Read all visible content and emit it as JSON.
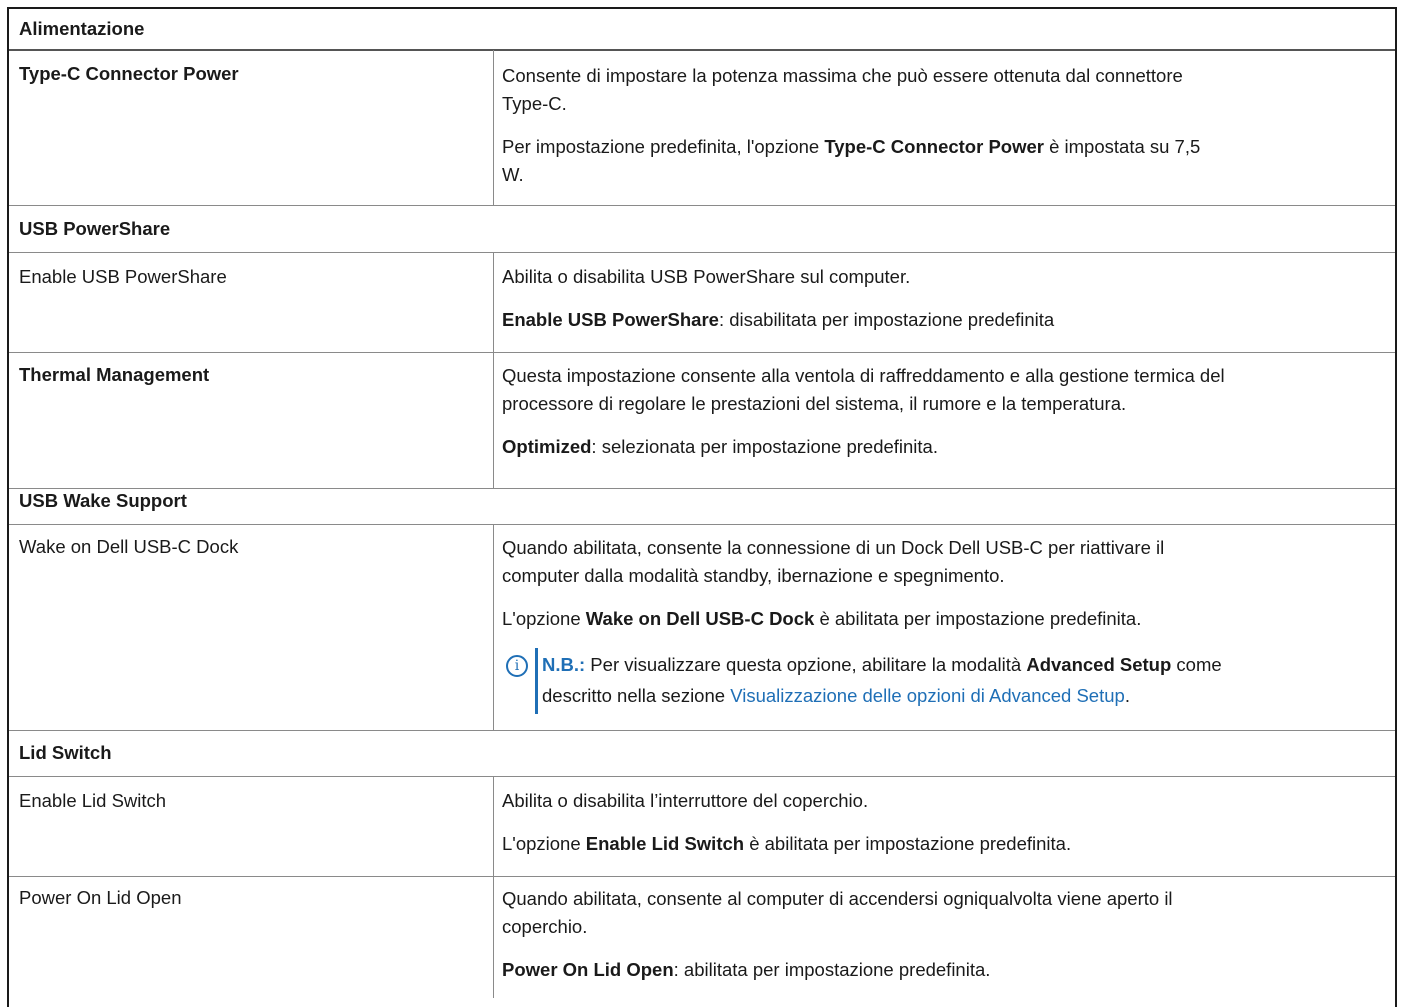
{
  "table": {
    "header": "Alimentazione",
    "type_c": {
      "name": "Type-C Connector Power",
      "desc_line1": "Consente di impostare la potenza massima che può essere ottenuta dal connettore",
      "desc_line2": "Type-C.",
      "default_pre": "Per impostazione predefinita, l'opzione ",
      "default_bold": "Type-C Connector Power",
      "default_post": " è impostata su 7,5",
      "default_line2": "W."
    },
    "usb_powershare": {
      "section": "USB PowerShare",
      "name": "Enable USB PowerShare",
      "desc": "Abilita o disabilita USB PowerShare sul computer.",
      "default_bold": "Enable USB PowerShare",
      "default_post": ": disabilitata per impostazione predefinita"
    },
    "thermal": {
      "name": "Thermal Management",
      "desc_line1": "Questa impostazione consente alla ventola di raffreddamento e alla gestione termica del",
      "desc_line2": "processore di regolare le prestazioni del sistema, il rumore e la temperatura.",
      "default_bold": "Optimized",
      "default_post": ": selezionata per impostazione predefinita."
    },
    "usb_wake": {
      "section": "USB Wake Support",
      "name": "Wake on Dell USB-C Dock",
      "desc_line1": "Quando abilitata, consente la connessione di un Dock Dell USB-C per riattivare il",
      "desc_line2": "computer dalla modalità standby, ibernazione e spegnimento.",
      "default_pre": "L'opzione ",
      "default_bold": "Wake on Dell USB-C Dock",
      "default_post": " è abilitata per impostazione predefinita.",
      "note_label": "N.B.:",
      "note_pre": " Per visualizzare questa opzione, abilitare la modalità ",
      "note_bold": "Advanced Setup",
      "note_post": " come",
      "note_line2_pre": "descritto nella sezione ",
      "note_link": "Visualizzazione delle opzioni di Advanced Setup",
      "note_line2_post": ".",
      "info_icon_glyph": "i"
    },
    "lid_switch": {
      "section": "Lid Switch",
      "name": "Enable Lid Switch",
      "desc": "Abilita o disabilita l’interruttore del coperchio.",
      "default_pre": "L'opzione ",
      "default_bold": "Enable Lid Switch",
      "default_post": " è abilitata per impostazione predefinita."
    },
    "power_on_lid": {
      "name": "Power On Lid Open",
      "desc_line1": "Quando abilitata, consente al computer di accendersi ogniqualvolta viene aperto il",
      "desc_line2": "coperchio.",
      "default_bold": "Power On Lid Open",
      "default_post": ": abilitata per impostazione predefinita."
    }
  },
  "colors": {
    "link": "#1f6fb6",
    "text": "#1a1a1a",
    "border": "#8a8a8a"
  }
}
